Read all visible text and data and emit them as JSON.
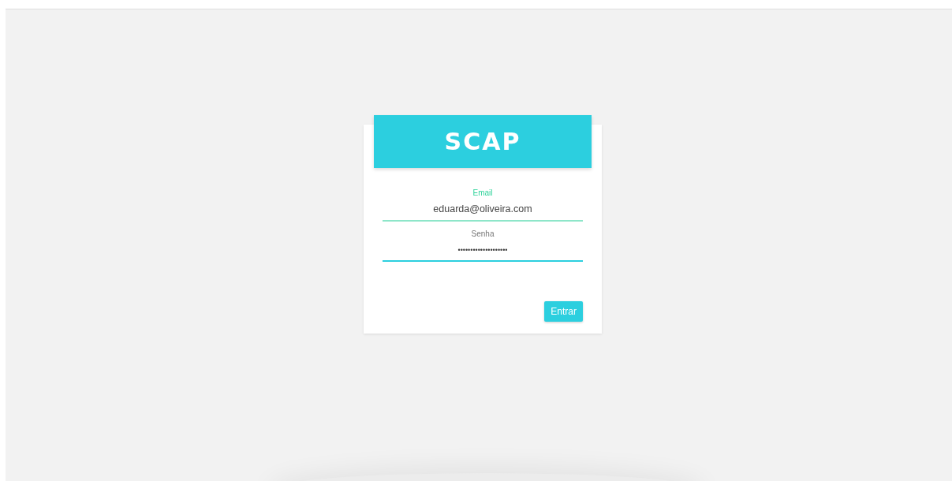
{
  "logo": {
    "text": "SCAP"
  },
  "fields": [
    {
      "label": "Email",
      "value": "eduarda@oliveira.com",
      "kind": "text",
      "focused": true
    },
    {
      "label": "Senha",
      "value": "••••••••••••••••••••",
      "kind": "password",
      "focused": false
    }
  ],
  "submit_button": {
    "label": "Entrar"
  }
}
